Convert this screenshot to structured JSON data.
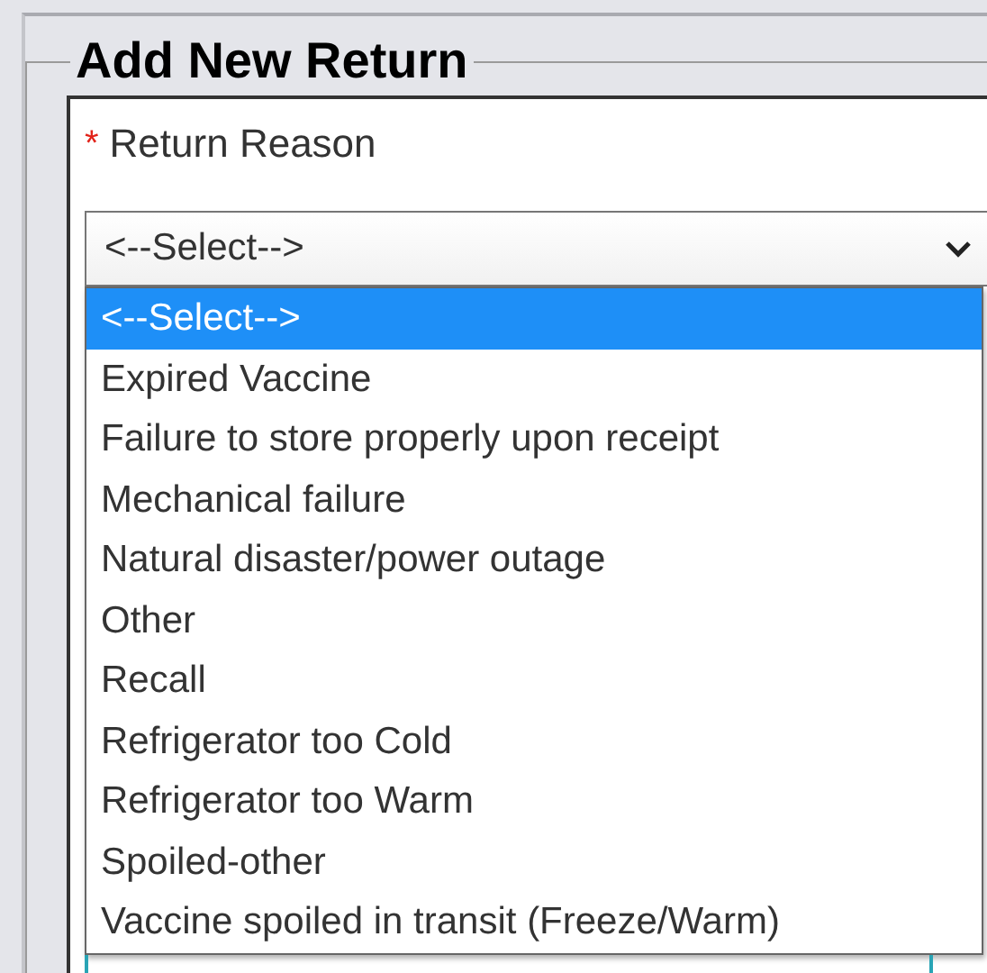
{
  "section": {
    "title": "Add New Return"
  },
  "field": {
    "label": "Return Reason",
    "required_mark": "*",
    "value": "<--Select-->",
    "expanded": true
  },
  "options": [
    {
      "label": "<--Select-->",
      "selected": true
    },
    {
      "label": "Expired Vaccine",
      "selected": false
    },
    {
      "label": "Failure to store properly upon receipt",
      "selected": false
    },
    {
      "label": "Mechanical failure",
      "selected": false
    },
    {
      "label": "Natural disaster/power outage",
      "selected": false
    },
    {
      "label": "Other",
      "selected": false
    },
    {
      "label": "Recall",
      "selected": false
    },
    {
      "label": "Refrigerator too Cold",
      "selected": false
    },
    {
      "label": "Refrigerator too Warm",
      "selected": false
    },
    {
      "label": "Spoiled-other",
      "selected": false
    },
    {
      "label": "Vaccine spoiled in transit (Freeze/Warm)",
      "selected": false
    }
  ]
}
